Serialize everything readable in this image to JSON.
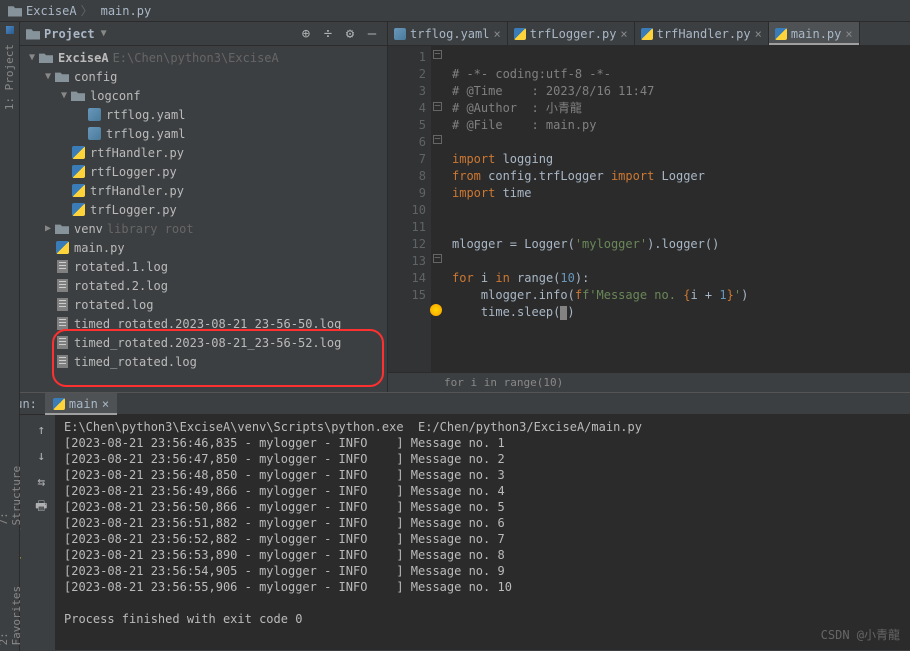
{
  "breadcrumb": {
    "root": "ExciseA",
    "file": "main.py"
  },
  "project": {
    "title": "Project",
    "tree": {
      "root": {
        "name": "ExciseA",
        "path": "E:\\Chen\\python3\\ExciseA"
      },
      "config": "config",
      "logconf": "logconf",
      "rtflog": "rtflog.yaml",
      "trflog": "trflog.yaml",
      "rtfHandler": "rtfHandler.py",
      "rtfLogger": "rtfLogger.py",
      "trfHandler": "trfHandler.py",
      "trfLogger": "trfLogger.py",
      "venv": "venv",
      "venv_hint": "library root",
      "main": "main.py",
      "rot1": "rotated.1.log",
      "rot2": "rotated.2.log",
      "rot": "rotated.log",
      "tr1": "timed_rotated.2023-08-21_23-56-50.log",
      "tr2": "timed_rotated.2023-08-21_23-56-52.log",
      "tr3": "timed_rotated.log"
    }
  },
  "tabs": [
    {
      "label": "trflog.yaml"
    },
    {
      "label": "trfLogger.py"
    },
    {
      "label": "trfHandler.py"
    },
    {
      "label": "main.py",
      "active": true
    }
  ],
  "code": {
    "lines": 15,
    "l1": "# -*- coding:utf-8 -*-",
    "l2a": "# @Time    : 2023/8/16 11:47",
    "l3a": "# @Author  : 小青龍",
    "l4a": "# @File    : main.py",
    "l6_kw": "import",
    "l6_mod": " logging",
    "l7_kw1": "from",
    "l7_mod": " config.trfLogger ",
    "l7_kw2": "import",
    "l7_id": " Logger",
    "l8_kw": "import",
    "l8_mod": " time",
    "l11_a": "mlogger = Logger(",
    "l11_s": "'mylogger'",
    "l11_b": ").logger()",
    "l13_kw1": "for",
    "l13_a": " i ",
    "l13_kw2": "in",
    "l13_b": " range(",
    "l13_n": "10",
    "l13_c": "):",
    "l14_a": "    mlogger.info(",
    "l14_f": "f'Message no. ",
    "l14_b1": "{",
    "l14_e": "i + ",
    "l14_n1": "1",
    "l14_b2": "}",
    "l14_fe": "'",
    "l14_c": ")",
    "l15_a": "    time.sleep(",
    "l15_n": "1",
    "l15_c": ")"
  },
  "crumb_hint": "for i in range(10)",
  "run": {
    "label": "Run:",
    "tab": "main",
    "cmdline": "E:\\Chen\\python3\\ExciseA\\venv\\Scripts\\python.exe  E:/Chen/python3/ExciseA/main.py",
    "rows": [
      "[2023-08-21 23:56:46,835 - mylogger - INFO    ] Message no. 1",
      "[2023-08-21 23:56:47,850 - mylogger - INFO    ] Message no. 2",
      "[2023-08-21 23:56:48,850 - mylogger - INFO    ] Message no. 3",
      "[2023-08-21 23:56:49,866 - mylogger - INFO    ] Message no. 4",
      "[2023-08-21 23:56:50,866 - mylogger - INFO    ] Message no. 5",
      "[2023-08-21 23:56:51,882 - mylogger - INFO    ] Message no. 6",
      "[2023-08-21 23:56:52,882 - mylogger - INFO    ] Message no. 7",
      "[2023-08-21 23:56:53,890 - mylogger - INFO    ] Message no. 8",
      "[2023-08-21 23:56:54,905 - mylogger - INFO    ] Message no. 9",
      "[2023-08-21 23:56:55,906 - mylogger - INFO    ] Message no. 10"
    ],
    "exit": "Process finished with exit code 0"
  },
  "left_tools": {
    "project": "1: Project",
    "structure": "7: Structure",
    "favorites": "2: Favorites"
  },
  "watermark": "CSDN @小青龍"
}
